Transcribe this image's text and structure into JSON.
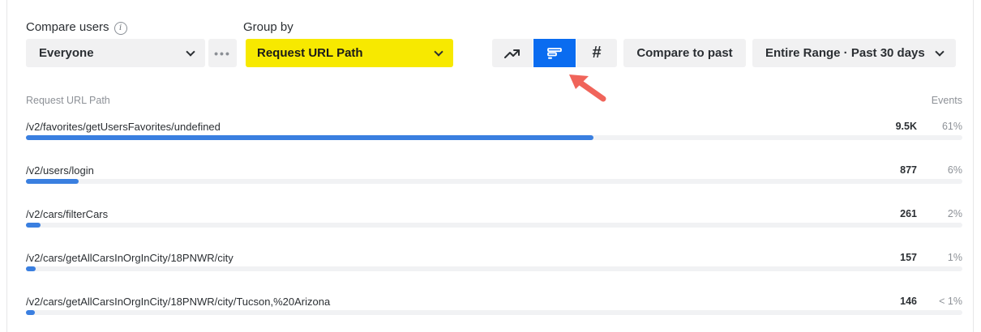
{
  "compare": {
    "label": "Compare users",
    "info_icon": "info-icon",
    "value": "Everyone",
    "more_icon": "more-horizontal-icon"
  },
  "group_by": {
    "label": "Group by",
    "value": "Request URL Path",
    "highlight_color": "#f7e900"
  },
  "view_toggle": {
    "active": "bar",
    "active_color": "#0a6cf0",
    "number_glyph": "#"
  },
  "compare_past": {
    "label": "Compare to past"
  },
  "range": {
    "label": "Entire Range · Past 30 days"
  },
  "table": {
    "column_left": "Request URL Path",
    "column_right": "Events",
    "bar_color": "#3a7fe0",
    "rows": [
      {
        "path": "/v2/favorites/getUsersFavorites/undefined",
        "value": "9.5K",
        "percent": "61%",
        "fraction": 0.606
      },
      {
        "path": "/v2/users/login",
        "value": "877",
        "percent": "6%",
        "fraction": 0.056
      },
      {
        "path": "/v2/cars/filterCars",
        "value": "261",
        "percent": "2%",
        "fraction": 0.016
      },
      {
        "path": "/v2/cars/getAllCarsInOrgInCity/18PNWR/city",
        "value": "157",
        "percent": "1%",
        "fraction": 0.01
      },
      {
        "path": "/v2/cars/getAllCarsInOrgInCity/18PNWR/city/Tucson,%20Arizona",
        "value": "146",
        "percent": "< 1%",
        "fraction": 0.0095
      }
    ]
  },
  "annotation": {
    "arrow_color": "#f0645a"
  }
}
